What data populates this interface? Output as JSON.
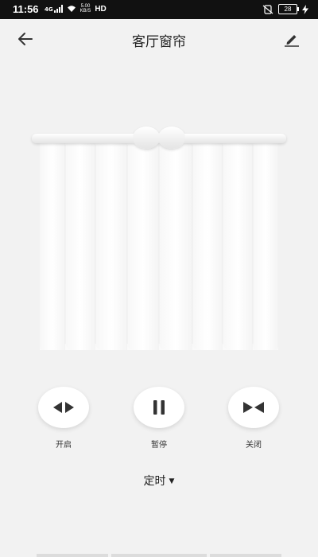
{
  "status_bar": {
    "time": "11:56",
    "network_label": "4G",
    "net_speed_value": "5.00",
    "net_speed_unit": "KB/S",
    "hd_label": "HD",
    "battery_level": "28",
    "icons": [
      "signal-icon",
      "wifi-icon",
      "silent-icon",
      "battery-icon",
      "charging-icon"
    ]
  },
  "header": {
    "title": "客厅窗帘",
    "back_icon": "arrow-left-icon",
    "edit_icon": "pencil-icon"
  },
  "controls": {
    "open_label": "开启",
    "pause_label": "暂停",
    "close_label": "关闭"
  },
  "timer": {
    "label": "定时",
    "caret_icon": "caret-down-icon"
  },
  "colors": {
    "background": "#f2f2f2",
    "curtain": "#ffffff",
    "icon": "#333333",
    "status_bar": "#111111"
  }
}
